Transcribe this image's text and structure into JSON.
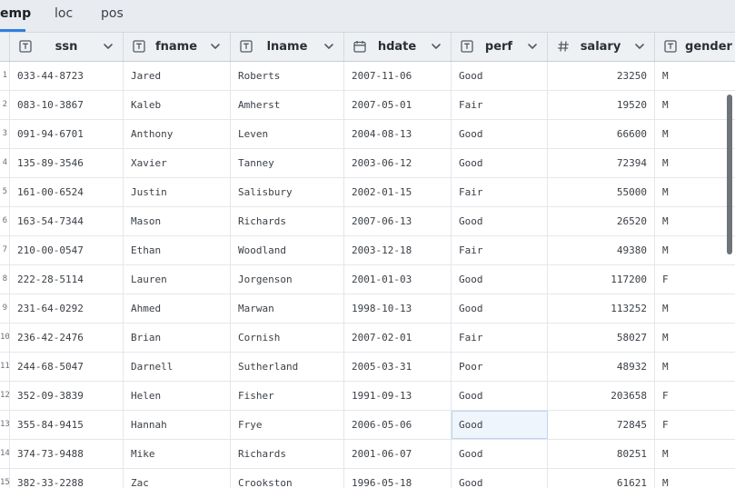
{
  "tabs": [
    {
      "label": "emp",
      "active": true
    },
    {
      "label": "loc",
      "active": false
    },
    {
      "label": "pos",
      "active": false
    }
  ],
  "columns": [
    {
      "key": "ssn",
      "label": "ssn",
      "type_icon": "text-type-icon"
    },
    {
      "key": "fname",
      "label": "fname",
      "type_icon": "text-type-icon"
    },
    {
      "key": "lname",
      "label": "lname",
      "type_icon": "text-type-icon"
    },
    {
      "key": "hdate",
      "label": "hdate",
      "type_icon": "calendar-icon"
    },
    {
      "key": "perf",
      "label": "perf",
      "type_icon": "text-type-icon"
    },
    {
      "key": "salary",
      "label": "salary",
      "type_icon": "number-hash-icon"
    },
    {
      "key": "gender",
      "label": "gender",
      "type_icon": "text-type-icon"
    }
  ],
  "rows": [
    {
      "n": "1",
      "ssn": "033-44-8723",
      "fname": "Jared",
      "lname": "Roberts",
      "hdate": "2007-11-06",
      "perf": "Good",
      "salary": "23250",
      "gender": "M"
    },
    {
      "n": "2",
      "ssn": "083-10-3867",
      "fname": "Kaleb",
      "lname": "Amherst",
      "hdate": "2007-05-01",
      "perf": "Fair",
      "salary": "19520",
      "gender": "M"
    },
    {
      "n": "3",
      "ssn": "091-94-6701",
      "fname": "Anthony",
      "lname": "Leven",
      "hdate": "2004-08-13",
      "perf": "Good",
      "salary": "66600",
      "gender": "M"
    },
    {
      "n": "4",
      "ssn": "135-89-3546",
      "fname": "Xavier",
      "lname": "Tanney",
      "hdate": "2003-06-12",
      "perf": "Good",
      "salary": "72394",
      "gender": "M"
    },
    {
      "n": "5",
      "ssn": "161-00-6524",
      "fname": "Justin",
      "lname": "Salisbury",
      "hdate": "2002-01-15",
      "perf": "Fair",
      "salary": "55000",
      "gender": "M"
    },
    {
      "n": "6",
      "ssn": "163-54-7344",
      "fname": "Mason",
      "lname": "Richards",
      "hdate": "2007-06-13",
      "perf": "Good",
      "salary": "26520",
      "gender": "M"
    },
    {
      "n": "7",
      "ssn": "210-00-0547",
      "fname": "Ethan",
      "lname": "Woodland",
      "hdate": "2003-12-18",
      "perf": "Fair",
      "salary": "49380",
      "gender": "M"
    },
    {
      "n": "8",
      "ssn": "222-28-5114",
      "fname": "Lauren",
      "lname": "Jorgenson",
      "hdate": "2001-01-03",
      "perf": "Good",
      "salary": "117200",
      "gender": "F"
    },
    {
      "n": "9",
      "ssn": "231-64-0292",
      "fname": "Ahmed",
      "lname": "Marwan",
      "hdate": "1998-10-13",
      "perf": "Good",
      "salary": "113252",
      "gender": "M"
    },
    {
      "n": "10",
      "ssn": "236-42-2476",
      "fname": "Brian",
      "lname": "Cornish",
      "hdate": "2007-02-01",
      "perf": "Fair",
      "salary": "58027",
      "gender": "M"
    },
    {
      "n": "11",
      "ssn": "244-68-5047",
      "fname": "Darnell",
      "lname": "Sutherland",
      "hdate": "2005-03-31",
      "perf": "Poor",
      "salary": "48932",
      "gender": "M"
    },
    {
      "n": "12",
      "ssn": "352-09-3839",
      "fname": "Helen",
      "lname": "Fisher",
      "hdate": "1991-09-13",
      "perf": "Good",
      "salary": "203658",
      "gender": "F"
    },
    {
      "n": "13",
      "ssn": "355-84-9415",
      "fname": "Hannah",
      "lname": "Frye",
      "hdate": "2006-05-06",
      "perf": "Good",
      "salary": "72845",
      "gender": "F"
    },
    {
      "n": "14",
      "ssn": "374-73-9488",
      "fname": "Mike",
      "lname": "Richards",
      "hdate": "2001-06-07",
      "perf": "Good",
      "salary": "80251",
      "gender": "M"
    },
    {
      "n": "15",
      "ssn": "382-33-2288",
      "fname": "Zac",
      "lname": "Crookston",
      "hdate": "1996-05-18",
      "perf": "Good",
      "salary": "61621",
      "gender": "M"
    }
  ],
  "selected_cell": {
    "row": 12,
    "column": "perf"
  },
  "colors": {
    "accent": "#2f7fe0",
    "header_bg": "#eef1f4",
    "tabbar_bg": "#e8ebef",
    "selection_bg": "#eef5fc"
  }
}
